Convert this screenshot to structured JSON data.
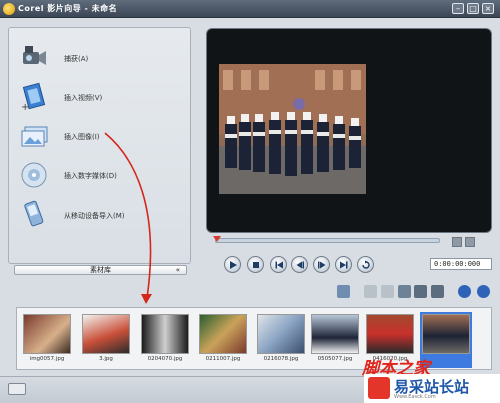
{
  "window": {
    "title": "Corel 影片向导 - 未命名",
    "controls": [
      "–",
      "□",
      "×"
    ]
  },
  "actions": [
    {
      "label": "捕获(A)",
      "icon": "camcorder-icon"
    },
    {
      "label": "插入视频(V)",
      "icon": "film-icon"
    },
    {
      "label": "插入图像(I)",
      "icon": "picture-icon"
    },
    {
      "label": "插入数字媒体(D)",
      "icon": "disc-icon"
    },
    {
      "label": "从移动设备导入(M)",
      "icon": "mobile-device-icon"
    }
  ],
  "library": {
    "label": "素材库",
    "toggle": "«"
  },
  "player": {
    "timecode": "0:00:00:000",
    "progress": 0
  },
  "thumbnails": [
    {
      "caption": "img0057.jpg",
      "selected": false
    },
    {
      "caption": "3.jpg",
      "selected": false
    },
    {
      "caption": "0204070.jpg",
      "selected": false
    },
    {
      "caption": "0211007.jpg",
      "selected": false
    },
    {
      "caption": "0216078.jpg",
      "selected": false
    },
    {
      "caption": "0505077.jpg",
      "selected": false
    },
    {
      "caption": "0416020.jpg",
      "selected": false
    },
    {
      "caption": "",
      "selected": true
    }
  ],
  "watermark": {
    "line1": "脚本之家",
    "line2": "易采站长站",
    "sub": "Www.Easck.Com"
  },
  "colors": {
    "accent": "#3d7be0",
    "arrow": "#d3271a"
  }
}
